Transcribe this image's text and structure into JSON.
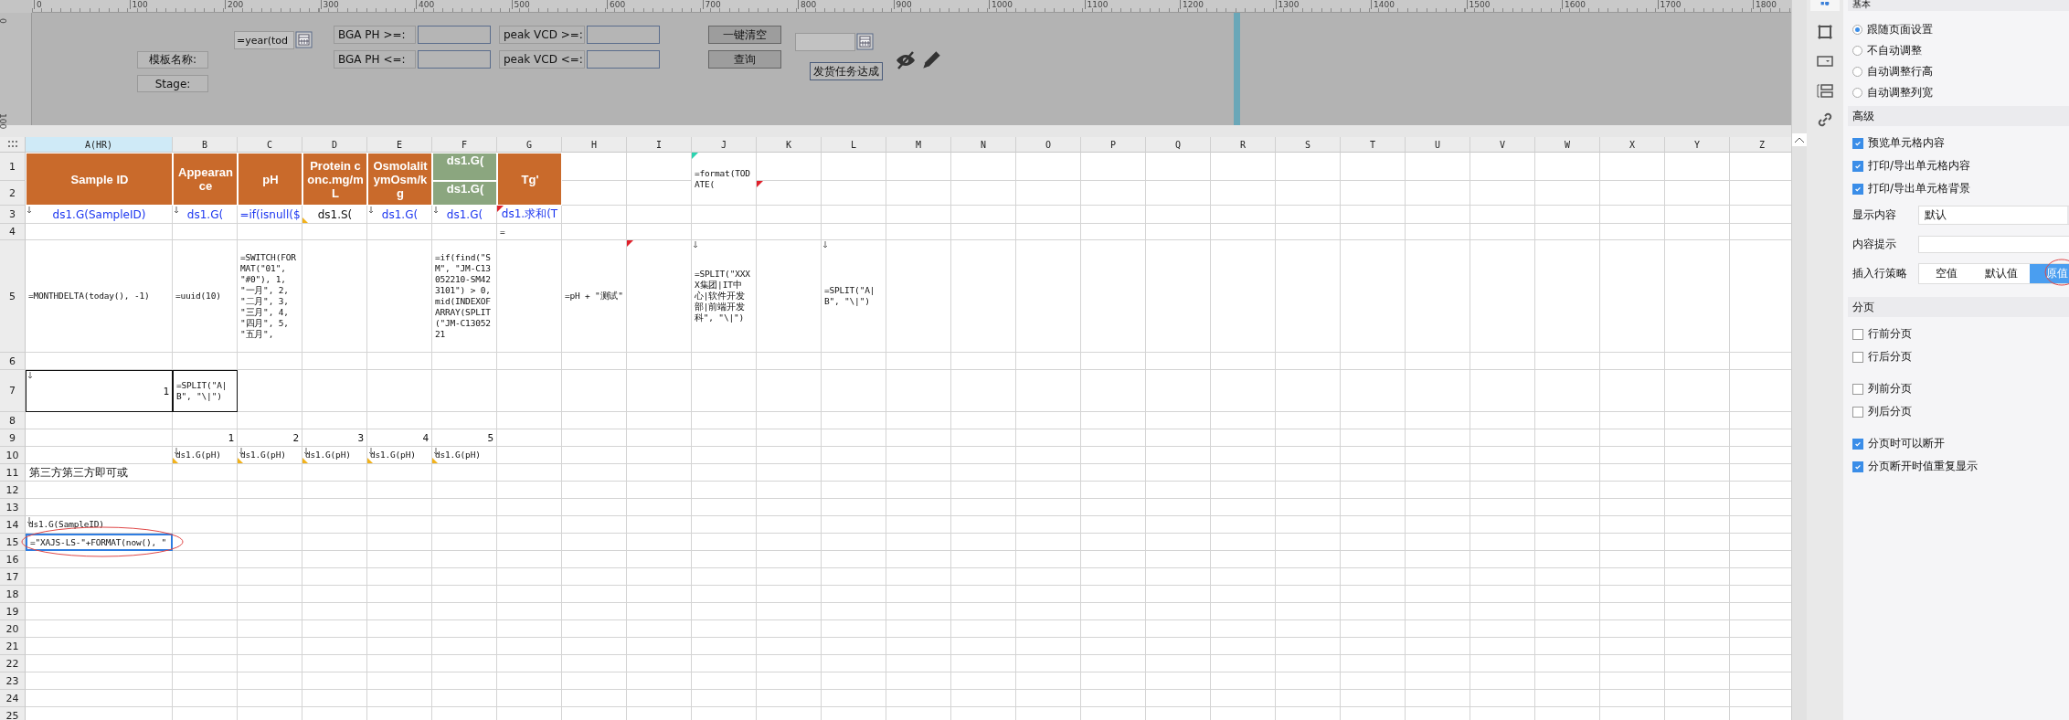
{
  "ruler": {
    "h_labels": [
      "0",
      "100",
      "200",
      "300",
      "400",
      "500",
      "600",
      "700",
      "800",
      "900",
      "1000",
      "1100",
      "1200",
      "1300",
      "1400",
      "1500",
      "1600",
      "1700",
      "1800"
    ],
    "v_labels": [
      "0",
      "100"
    ]
  },
  "form": {
    "label_boxes": [
      "模板名称:",
      "Stage:"
    ],
    "date_input": {
      "value": "=year(tod"
    },
    "filters": [
      {
        "label": "BGA PH >=:"
      },
      {
        "label": "BGA PH <=:"
      },
      {
        "label": "peak VCD >=:"
      },
      {
        "label": "peak VCD <=:"
      }
    ],
    "buttons": [
      "一键清空",
      "查询"
    ],
    "caption": "发货任务达成"
  },
  "sheet": {
    "columns": [
      {
        "label": "A(HR)",
        "selected": true
      },
      {
        "label": "B",
        "selected": false
      },
      {
        "label": "C",
        "selected": false
      },
      {
        "label": "D",
        "selected": false
      },
      {
        "label": "E",
        "selected": false
      },
      {
        "label": "F",
        "selected": false
      },
      {
        "label": "G",
        "selected": false
      },
      {
        "label": "H",
        "selected": false
      },
      {
        "label": "I",
        "selected": false
      },
      {
        "label": "J",
        "selected": false
      },
      {
        "label": "K",
        "selected": false
      },
      {
        "label": "L",
        "selected": false
      },
      {
        "label": "M",
        "selected": false
      },
      {
        "label": "N",
        "selected": false
      },
      {
        "label": "O",
        "selected": false
      },
      {
        "label": "P",
        "selected": false
      },
      {
        "label": "Q",
        "selected": false
      },
      {
        "label": "R",
        "selected": false
      },
      {
        "label": "S",
        "selected": false
      },
      {
        "label": "T",
        "selected": false
      },
      {
        "label": "U",
        "selected": false
      },
      {
        "label": "V",
        "selected": false
      },
      {
        "label": "W",
        "selected": false
      },
      {
        "label": "X",
        "selected": false
      },
      {
        "label": "Y",
        "selected": false
      },
      {
        "label": "Z",
        "selected": false
      }
    ],
    "rows": [
      {
        "number": "1",
        "cells": {
          "A": {
            "kind": "header",
            "text": "Sample ID",
            "merged_down": true,
            "arrow": false,
            "tag": false,
            "selected": false
          },
          "B": {
            "kind": "header",
            "text": "Appearance",
            "merged_down": true,
            "arrow": false,
            "tag": false,
            "selected": false
          },
          "C": {
            "kind": "header",
            "text": "pH",
            "merged_down": true,
            "arrow": false,
            "tag": false,
            "selected": false
          },
          "D": {
            "kind": "header",
            "text": "Protein conc.mg/mL",
            "merged_down": true,
            "arrow": false,
            "tag": false,
            "selected": false
          },
          "E": {
            "kind": "header",
            "text": "OsmolalitymOsm/kg",
            "merged_down": true,
            "arrow": false,
            "tag": false,
            "selected": false
          },
          "F": {
            "kind": "header_alt",
            "text": "ds1.G(",
            "merged_down": false,
            "arrow": false,
            "tag": false,
            "selected": false
          },
          "G": {
            "kind": "header",
            "text": "Tg'",
            "merged_down": true,
            "arrow": false,
            "tag": false,
            "selected": false
          },
          "J": {
            "kind": "formula",
            "text": "=format(TODATE(",
            "color": "#2ad4b0",
            "merged_down": true,
            "arrow": false,
            "tag": false,
            "selected": false
          }
        }
      },
      {
        "number": "2",
        "cells": {
          "F": {
            "kind": "header_alt",
            "text": "ds1.G(",
            "arrow": false,
            "tag": false,
            "selected": false
          },
          "K": {
            "color": "#e0202a",
            "arrow": false,
            "tag": false,
            "selected": false
          }
        }
      },
      {
        "number": "3",
        "cells": {
          "A": {
            "kind": "binding",
            "text": "ds1.G(SampleID)",
            "arrow": true,
            "tag": false,
            "selected": false
          },
          "B": {
            "kind": "binding",
            "text": "ds1.G(",
            "arrow": true,
            "tag": false,
            "selected": false
          },
          "C": {
            "kind": "binding",
            "text": "=if(isnull($",
            "arrow": false,
            "tag": false,
            "selected": false
          },
          "D": {
            "kind": "label",
            "text": "ds1.S(",
            "arrow": false,
            "tag": true,
            "selected": false
          },
          "E": {
            "kind": "binding",
            "text": "ds1.G(",
            "arrow": true,
            "tag": false,
            "selected": false
          },
          "F": {
            "kind": "binding",
            "text": "ds1.G(",
            "arrow": true,
            "tag": false,
            "selected": false
          },
          "G": {
            "kind": "binding",
            "text": "ds1.求和(T",
            "color": "#e0202a",
            "arrow": false,
            "tag": false,
            "selected": false
          }
        }
      },
      {
        "number": "4",
        "cells": {
          "G": {
            "kind": "formula",
            "text": "=",
            "arrow": false,
            "tag": false,
            "selected": false
          }
        }
      },
      {
        "number": "5",
        "cells": {
          "A": {
            "kind": "formula",
            "text": "=MONTHDELTA(today(), -1)",
            "arrow": false,
            "tag": false,
            "selected": false
          },
          "B": {
            "kind": "formula",
            "text": "=uuid(10)",
            "arrow": false,
            "tag": false,
            "selected": false
          },
          "C": {
            "kind": "formula",
            "text": "=SWITCH(FORMAT(\"01\", \"#0\"), 1, \"一月\", 2, \"二月\", 3, \"三月\", 4, \"四月\", 5, \"五月\",",
            "arrow": false,
            "tag": false,
            "selected": false
          },
          "F": {
            "kind": "formula",
            "text": "=if(find(\"SM\", \"JM-C13052210-SM423101\") > 0, mid(INDEXOFARRAY(SPLIT(\"JM-C1305221",
            "arrow": false,
            "tag": false,
            "selected": false
          },
          "H": {
            "kind": "formula",
            "text": "=pH + \"测试\"",
            "arrow": false,
            "tag": false,
            "selected": false
          },
          "I": {
            "color": "#e0202a",
            "arrow": false,
            "tag": false,
            "selected": false
          },
          "J": {
            "kind": "formula",
            "text": "=SPLIT(\"XXXX集团|IT中心|软件开发部|前端开发科\", \"\\|\")",
            "arrow": true,
            "tag": false,
            "selected": false
          },
          "L": {
            "kind": "formula",
            "text": "=SPLIT(\"A|B\", \"\\|\")",
            "arrow": true,
            "tag": false,
            "selected": false
          }
        }
      },
      {
        "number": "6",
        "cells": {}
      },
      {
        "number": "7",
        "cells": {
          "A": {
            "kind": "number",
            "text": "1",
            "arrow": true,
            "tag": false,
            "outlined": true,
            "selected": false
          },
          "B": {
            "kind": "formula",
            "text": "=SPLIT(\"A|B\", \"\\|\")",
            "arrow": false,
            "tag": false,
            "outlined": true,
            "selected": false
          }
        }
      },
      {
        "number": "8",
        "cells": {}
      },
      {
        "number": "9",
        "cells": {
          "B": {
            "kind": "number",
            "text": "1",
            "arrow": false,
            "tag": false,
            "selected": false
          },
          "C": {
            "kind": "number",
            "text": "2",
            "arrow": false,
            "tag": false,
            "selected": false
          },
          "D": {
            "kind": "number",
            "text": "3",
            "arrow": false,
            "tag": false,
            "selected": false
          },
          "E": {
            "kind": "number",
            "text": "4",
            "arrow": false,
            "tag": false,
            "selected": false
          },
          "F": {
            "kind": "number",
            "text": "5",
            "arrow": false,
            "tag": false,
            "selected": false
          }
        }
      },
      {
        "number": "10",
        "cells": {
          "B": {
            "kind": "formula",
            "text": "ds1.G(pH)",
            "arrow": true,
            "tag": true,
            "selected": false
          },
          "C": {
            "kind": "formula",
            "text": "ds1.G(pH)",
            "arrow": true,
            "tag": true,
            "selected": false
          },
          "D": {
            "kind": "formula",
            "text": "ds1.G(pH)",
            "arrow": true,
            "tag": true,
            "selected": false
          },
          "E": {
            "kind": "formula",
            "text": "ds1.G(pH)",
            "arrow": true,
            "tag": true,
            "selected": false
          },
          "F": {
            "kind": "formula",
            "text": "ds1.G(pH)",
            "arrow": true,
            "tag": true,
            "selected": false
          }
        }
      },
      {
        "number": "11",
        "cells": {
          "A": {
            "kind": "note",
            "text": "第三方第三方即可或",
            "arrow": false,
            "tag": false,
            "selected": false
          }
        }
      },
      {
        "number": "12",
        "cells": {}
      },
      {
        "number": "13",
        "cells": {}
      },
      {
        "number": "14",
        "cells": {
          "A": {
            "kind": "formula",
            "text": "ds1.G(SampleID)",
            "arrow": true,
            "tag": false,
            "selected": false
          }
        }
      },
      {
        "number": "15",
        "cells": {
          "A": {
            "kind": "formula",
            "text": "=\"XAJS-LS-\"+FORMAT(now(), \"",
            "arrow": false,
            "tag": false,
            "selected": true
          }
        }
      },
      {
        "number": "16",
        "cells": {}
      },
      {
        "number": "17",
        "cells": {}
      },
      {
        "number": "18",
        "cells": {}
      },
      {
        "number": "19",
        "cells": {}
      },
      {
        "number": "20",
        "cells": {}
      },
      {
        "number": "21",
        "cells": {}
      },
      {
        "number": "22",
        "cells": {}
      },
      {
        "number": "23",
        "cells": {}
      },
      {
        "number": "24",
        "cells": {}
      },
      {
        "number": "25",
        "cells": {}
      }
    ]
  },
  "panel": {
    "top_section": "基本",
    "fit_options": [
      {
        "label": "跟随页面设置",
        "selected": true
      },
      {
        "label": "不自动调整",
        "selected": false
      },
      {
        "label": "自动调整行高",
        "selected": false
      },
      {
        "label": "自动调整列宽",
        "selected": false
      }
    ],
    "advanced": {
      "title": "高级",
      "checks": [
        {
          "label": "预览单元格内容",
          "checked": true
        },
        {
          "label": "打印/导出单元格内容",
          "checked": true
        },
        {
          "label": "打印/导出单元格背景",
          "checked": true
        }
      ],
      "display": {
        "label": "显示内容",
        "value": "默认"
      },
      "hint": {
        "label": "内容提示"
      },
      "insert": {
        "label": "插入行策略",
        "options": [
          {
            "label": "空值",
            "selected": false
          },
          {
            "label": "默认值",
            "selected": false
          },
          {
            "label": "原值",
            "selected": true
          }
        ]
      }
    },
    "paging": {
      "title": "分页",
      "groups": [
        [
          {
            "label": "行前分页",
            "checked": false
          },
          {
            "label": "行后分页",
            "checked": false
          }
        ],
        [
          {
            "label": "列前分页",
            "checked": false
          },
          {
            "label": "列后分页",
            "checked": false
          }
        ],
        [
          {
            "label": "分页时可以断开",
            "checked": true
          },
          {
            "label": "分页断开时值重复显示",
            "checked": true
          }
        ]
      ]
    }
  }
}
